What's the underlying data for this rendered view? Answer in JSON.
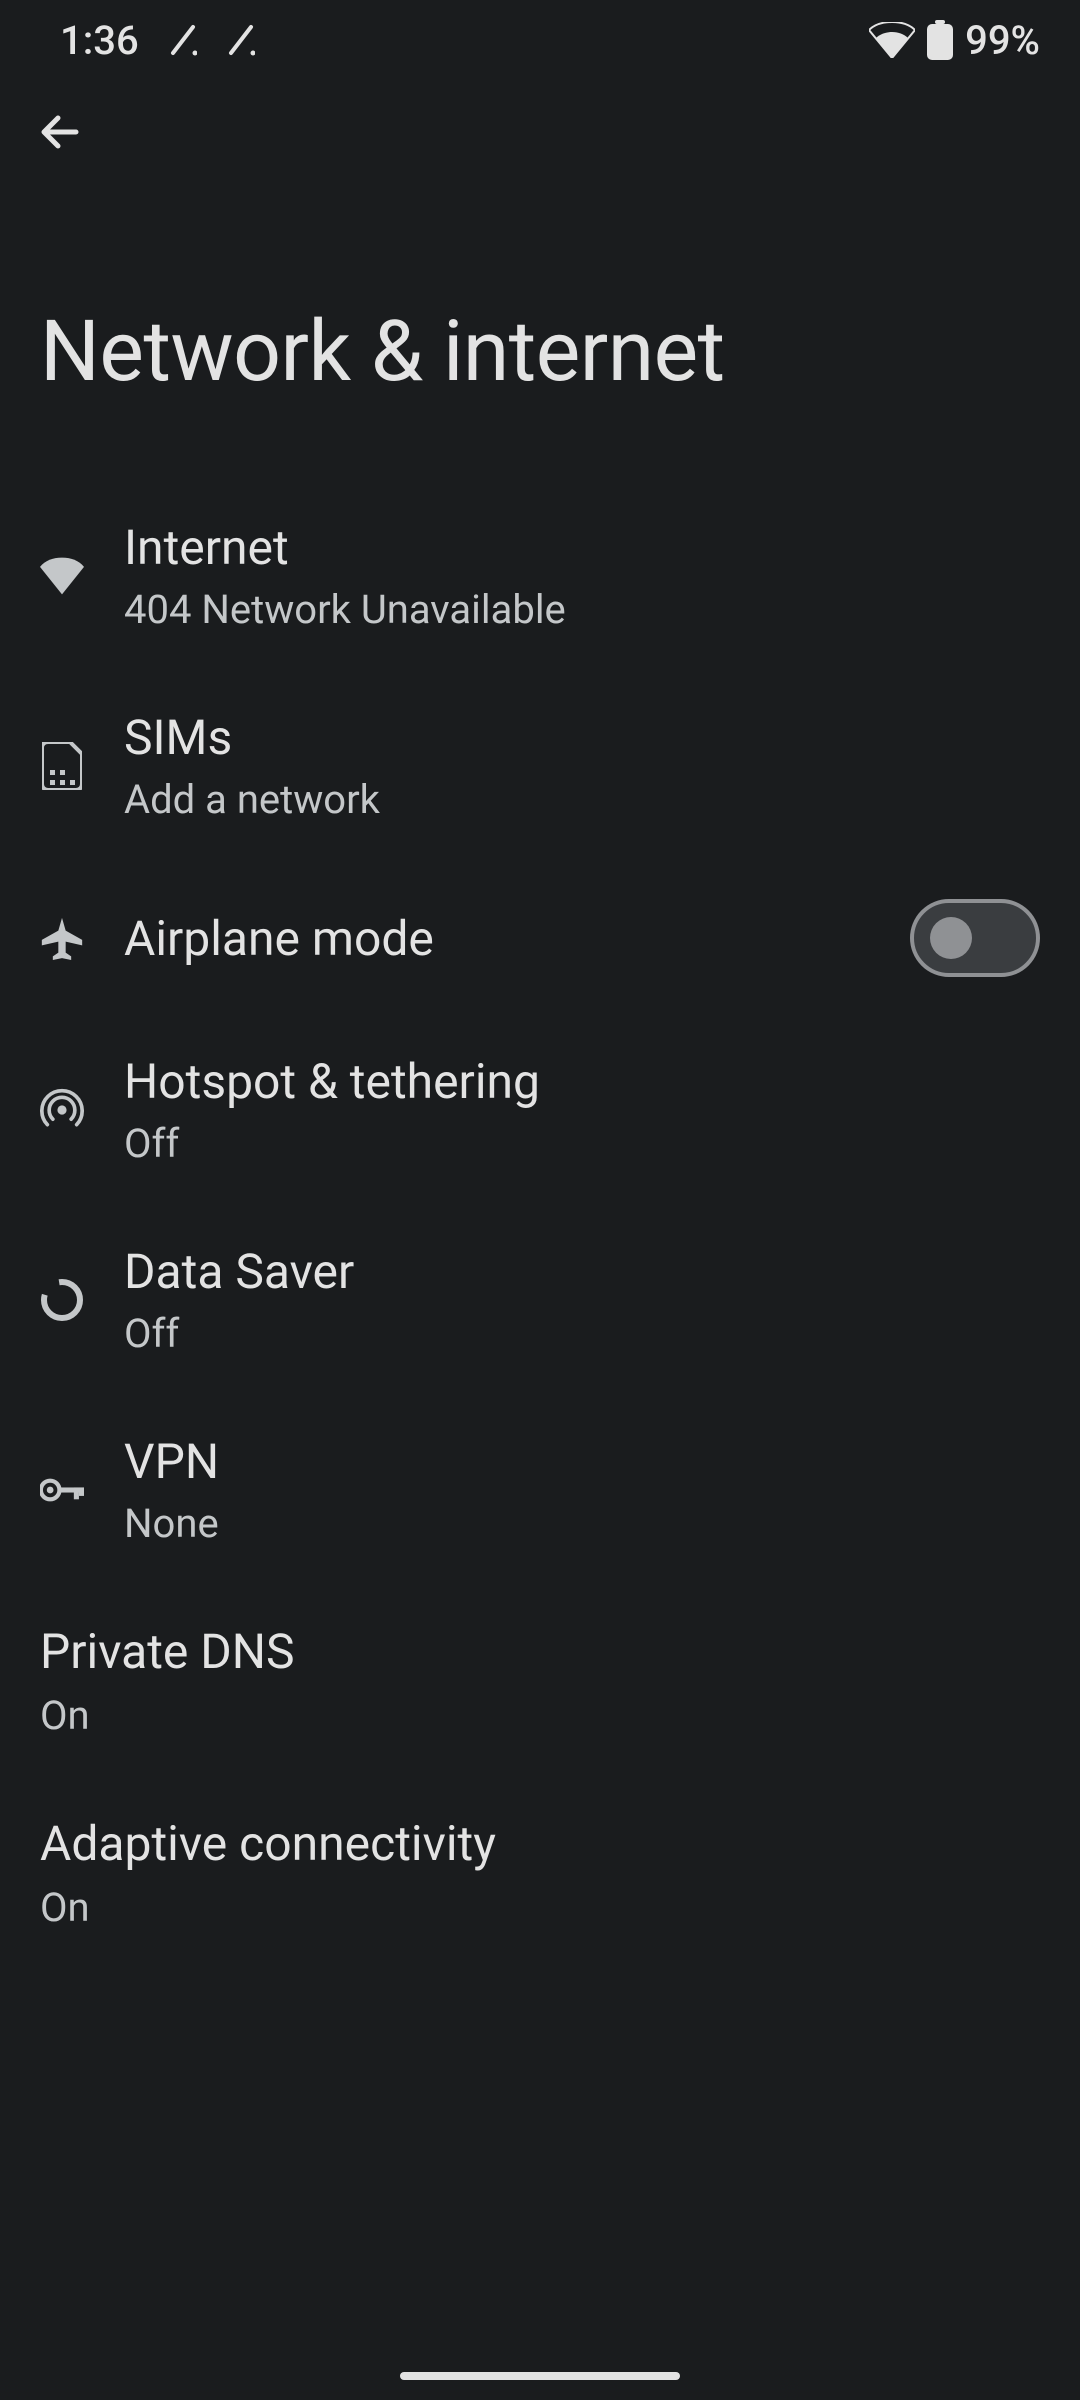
{
  "status": {
    "time": "1:36",
    "battery": "99%"
  },
  "page": {
    "title": "Network & internet"
  },
  "items": {
    "internet": {
      "title": "Internet",
      "subtitle": "404 Network Unavailable"
    },
    "sims": {
      "title": "SIMs",
      "subtitle": "Add a network"
    },
    "airplane": {
      "title": "Airplane mode",
      "toggle": false
    },
    "hotspot": {
      "title": "Hotspot & tethering",
      "subtitle": "Off"
    },
    "datasaver": {
      "title": "Data Saver",
      "subtitle": "Off"
    },
    "vpn": {
      "title": "VPN",
      "subtitle": "None"
    },
    "privatedns": {
      "title": "Private DNS",
      "subtitle": "On"
    },
    "adaptive": {
      "title": "Adaptive connectivity",
      "subtitle": "On"
    }
  }
}
